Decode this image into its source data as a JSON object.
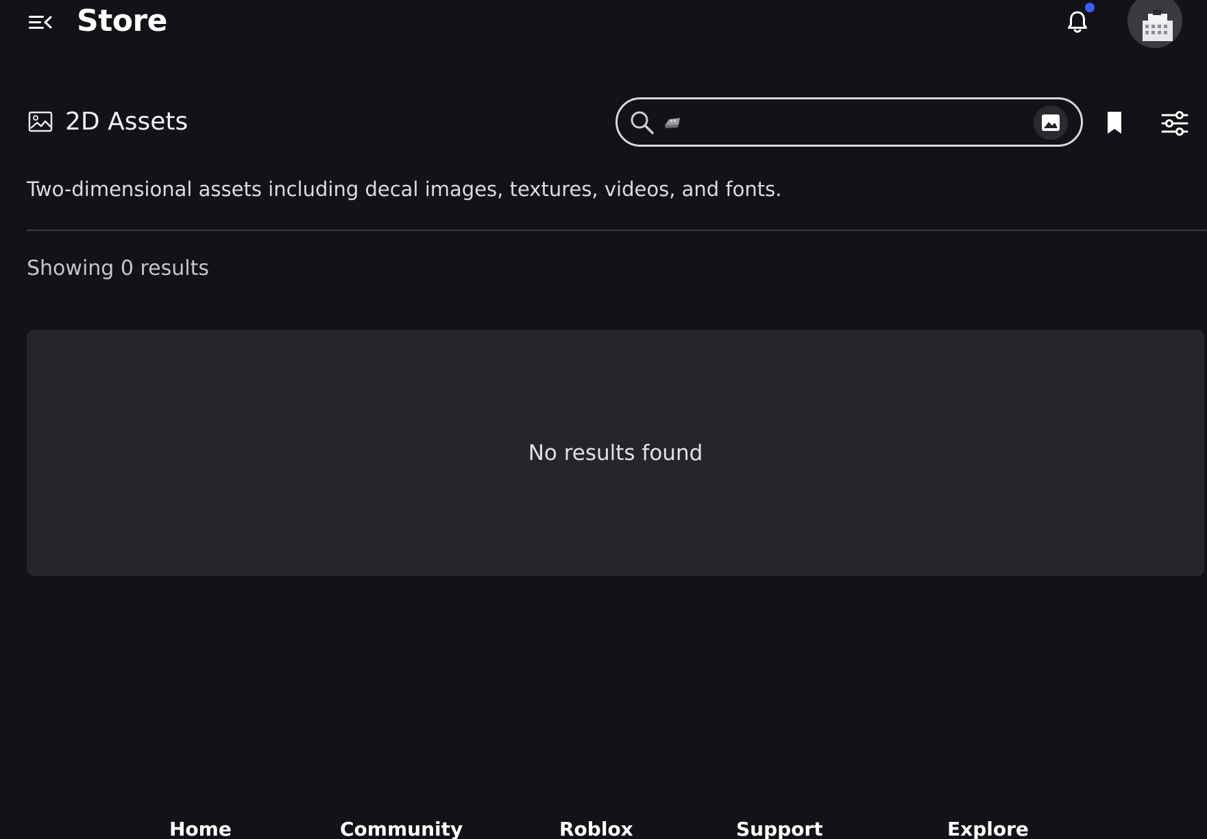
{
  "topbar": {
    "title": "Store",
    "menu_icon": "menu-collapse-icon",
    "notification_icon": "bell-icon",
    "notification_dot_color": "#3d5cff",
    "avatar_icon": "user-avatar"
  },
  "section": {
    "icon": "image-icon",
    "title": "2D Assets",
    "description": "Two-dimensional assets including decal images, textures, videos, and fonts."
  },
  "search": {
    "placeholder": "",
    "value": "",
    "search_icon": "search-icon",
    "query_thumbnail_icon": "image-thumbnail-icon",
    "image_search_icon": "image-search-icon"
  },
  "actions": {
    "bookmark_icon": "bookmark-icon",
    "filter_icon": "filter-sliders-icon"
  },
  "results": {
    "count_text": "Showing 0 results",
    "empty_message": "No results found"
  },
  "footer": {
    "links": [
      "Home",
      "Community",
      "Roblox",
      "Support",
      "Explore"
    ]
  },
  "colors": {
    "background": "#121217",
    "panel": "#25262a",
    "accent": "#3d5cff"
  }
}
